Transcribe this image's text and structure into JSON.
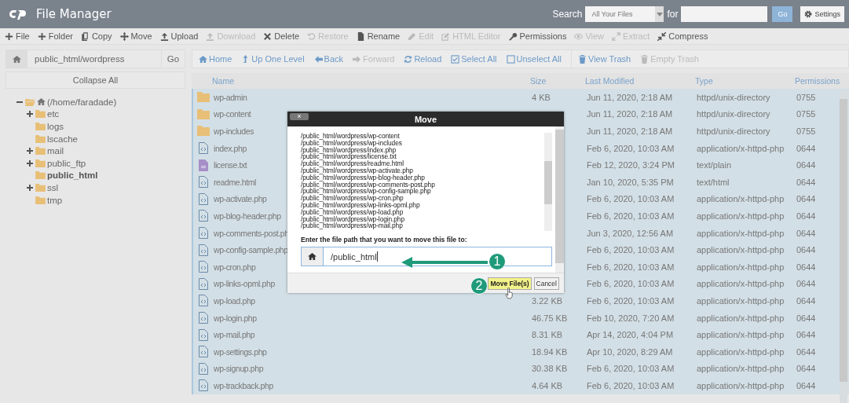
{
  "header": {
    "title": "File Manager",
    "search_label": "Search",
    "search_scope": "All Your Files",
    "for_label": "for",
    "go": "Go",
    "settings": "Settings"
  },
  "toolbar": [
    {
      "label": "File",
      "disabled": false
    },
    {
      "label": "Folder",
      "disabled": false
    },
    {
      "label": "Copy",
      "disabled": false
    },
    {
      "label": "Move",
      "disabled": false
    },
    {
      "label": "Upload",
      "disabled": false
    },
    {
      "label": "Download",
      "disabled": true
    },
    {
      "label": "Delete",
      "disabled": false
    },
    {
      "label": "Restore",
      "disabled": true
    },
    {
      "label": "Rename",
      "disabled": false
    },
    {
      "label": "Edit",
      "disabled": true
    },
    {
      "label": "HTML Editor",
      "disabled": true
    },
    {
      "label": "Permissions",
      "disabled": false
    },
    {
      "label": "View",
      "disabled": true
    },
    {
      "label": "Extract",
      "disabled": true
    },
    {
      "label": "Compress",
      "disabled": false
    }
  ],
  "sidebar": {
    "path": "public_html/wordpress",
    "go": "Go",
    "collapse": "Collapse All",
    "tree": {
      "label": "(/home/faradade)",
      "expanded": true,
      "children": [
        {
          "label": "etc",
          "expandable": true,
          "selected": false
        },
        {
          "label": "logs",
          "expandable": false,
          "selected": false
        },
        {
          "label": "lscache",
          "expandable": false,
          "selected": false
        },
        {
          "label": "mail",
          "expandable": true,
          "selected": false
        },
        {
          "label": "public_ftp",
          "expandable": true,
          "selected": false
        },
        {
          "label": "public_html",
          "expandable": false,
          "selected": true
        },
        {
          "label": "ssl",
          "expandable": true,
          "selected": false
        },
        {
          "label": "tmp",
          "expandable": false,
          "selected": false
        }
      ]
    }
  },
  "nav": [
    {
      "label": "Home",
      "disabled": false
    },
    {
      "label": "Up One Level",
      "disabled": false
    },
    {
      "label": "Back",
      "disabled": false
    },
    {
      "label": "Forward",
      "disabled": true
    },
    {
      "label": "Reload",
      "disabled": false
    },
    {
      "label": "Select All",
      "disabled": false
    },
    {
      "label": "Unselect All",
      "disabled": false
    },
    {
      "label": "View Trash",
      "disabled": false
    },
    {
      "label": "Empty Trash",
      "disabled": true
    }
  ],
  "table": {
    "columns": [
      "Name",
      "Size",
      "Last Modified",
      "Type",
      "Permissions"
    ],
    "rows": [
      {
        "kind": "folder",
        "name": "wp-admin",
        "size": "4 KB",
        "modified": "Jun 11, 2020, 2:18 AM",
        "type": "httpd/unix-directory",
        "perms": "0755",
        "selected": true
      },
      {
        "kind": "folder",
        "name": "wp-content",
        "modified": "Jun 11, 2020, 2:18 AM",
        "type": "httpd/unix-directory",
        "perms": "0755",
        "selected": true
      },
      {
        "kind": "folder",
        "name": "wp-includes",
        "modified": "Jun 11, 2020, 2:18 AM",
        "type": "httpd/unix-directory",
        "perms": "0755",
        "selected": true
      },
      {
        "kind": "code",
        "name": "index.php",
        "modified": "Feb 6, 2020, 10:03 AM",
        "type": "application/x-httpd-php",
        "perms": "0644",
        "selected": true
      },
      {
        "kind": "text",
        "name": "license.txt",
        "modified": "Feb 12, 2020, 3:24 PM",
        "type": "text/plain",
        "perms": "0644",
        "selected": true
      },
      {
        "kind": "code",
        "name": "readme.html",
        "modified": "Jan 10, 2020, 5:35 PM",
        "type": "text/html",
        "perms": "0644",
        "selected": true
      },
      {
        "kind": "code",
        "name": "wp-activate.php",
        "modified": "Feb 6, 2020, 10:03 AM",
        "type": "application/x-httpd-php",
        "perms": "0644",
        "selected": true
      },
      {
        "kind": "code",
        "name": "wp-blog-header.php",
        "modified": "Feb 6, 2020, 10:03 AM",
        "type": "application/x-httpd-php",
        "perms": "0644",
        "selected": true
      },
      {
        "kind": "code",
        "name": "wp-comments-post.ph",
        "modified": "Jun 3, 2020, 12:56 AM",
        "type": "application/x-httpd-php",
        "perms": "0644",
        "selected": true
      },
      {
        "kind": "code",
        "name": "wp-config-sample.php",
        "modified": "Feb 6, 2020, 10:03 AM",
        "type": "application/x-httpd-php",
        "perms": "0644",
        "selected": true
      },
      {
        "kind": "code",
        "name": "wp-cron.php",
        "modified": "Feb 6, 2020, 10:03 AM",
        "type": "application/x-httpd-php",
        "perms": "0644",
        "selected": true
      },
      {
        "kind": "code",
        "name": "wp-links-opml.php",
        "modified": "Feb 6, 2020, 10:03 AM",
        "type": "application/x-httpd-php",
        "perms": "0644",
        "selected": true
      },
      {
        "kind": "code",
        "name": "wp-load.php",
        "size": "3.22 KB",
        "modified": "Feb 6, 2020, 10:03 AM",
        "type": "application/x-httpd-php",
        "perms": "0644",
        "selected": true
      },
      {
        "kind": "code",
        "name": "wp-login.php",
        "size": "46.75 KB",
        "modified": "Feb 10, 2020, 7:20 AM",
        "type": "application/x-httpd-php",
        "perms": "0644",
        "selected": true
      },
      {
        "kind": "code",
        "name": "wp-mail.php",
        "size": "8.31 KB",
        "modified": "Apr 14, 2020, 4:04 PM",
        "type": "application/x-httpd-php",
        "perms": "0644",
        "selected": true
      },
      {
        "kind": "code",
        "name": "wp-settings.php",
        "size": "18.94 KB",
        "modified": "Apr 10, 2020, 8:29 AM",
        "type": "application/x-httpd-php",
        "perms": "0644",
        "selected": true
      },
      {
        "kind": "code",
        "name": "wp-signup.php",
        "size": "30.38 KB",
        "modified": "Feb 6, 2020, 10:03 AM",
        "type": "application/x-httpd-php",
        "perms": "0644",
        "selected": true
      },
      {
        "kind": "code",
        "name": "wp-trackback.php",
        "size": "4.64 KB",
        "modified": "Feb 6, 2020, 10:03 AM",
        "type": "application/x-httpd-php",
        "perms": "0644",
        "selected": true
      }
    ]
  },
  "dialog": {
    "title": "Move",
    "close": "×",
    "files": [
      "/public_html/wordpress/wp-content",
      "/public_html/wordpress/wp-includes",
      "/public_html/wordpress/index.php",
      "/public_html/wordpress/license.txt",
      "/public_html/wordpress/readme.html",
      "/public_html/wordpress/wp-activate.php",
      "/public_html/wordpress/wp-blog-header.php",
      "/public_html/wordpress/wp-comments-post.php",
      "/public_html/wordpress/wp-config-sample.php",
      "/public_html/wordpress/wp-cron.php",
      "/public_html/wordpress/wp-links-opml.php",
      "/public_html/wordpress/wp-load.php",
      "/public_html/wordpress/wp-login.php",
      "/public_html/wordpress/wp-mail.php"
    ],
    "prompt": "Enter the file path that you want to move this file to:",
    "path": "/public_html",
    "move": "Move File(s)",
    "cancel": "Cancel"
  },
  "annotations": [
    "1",
    "2"
  ]
}
